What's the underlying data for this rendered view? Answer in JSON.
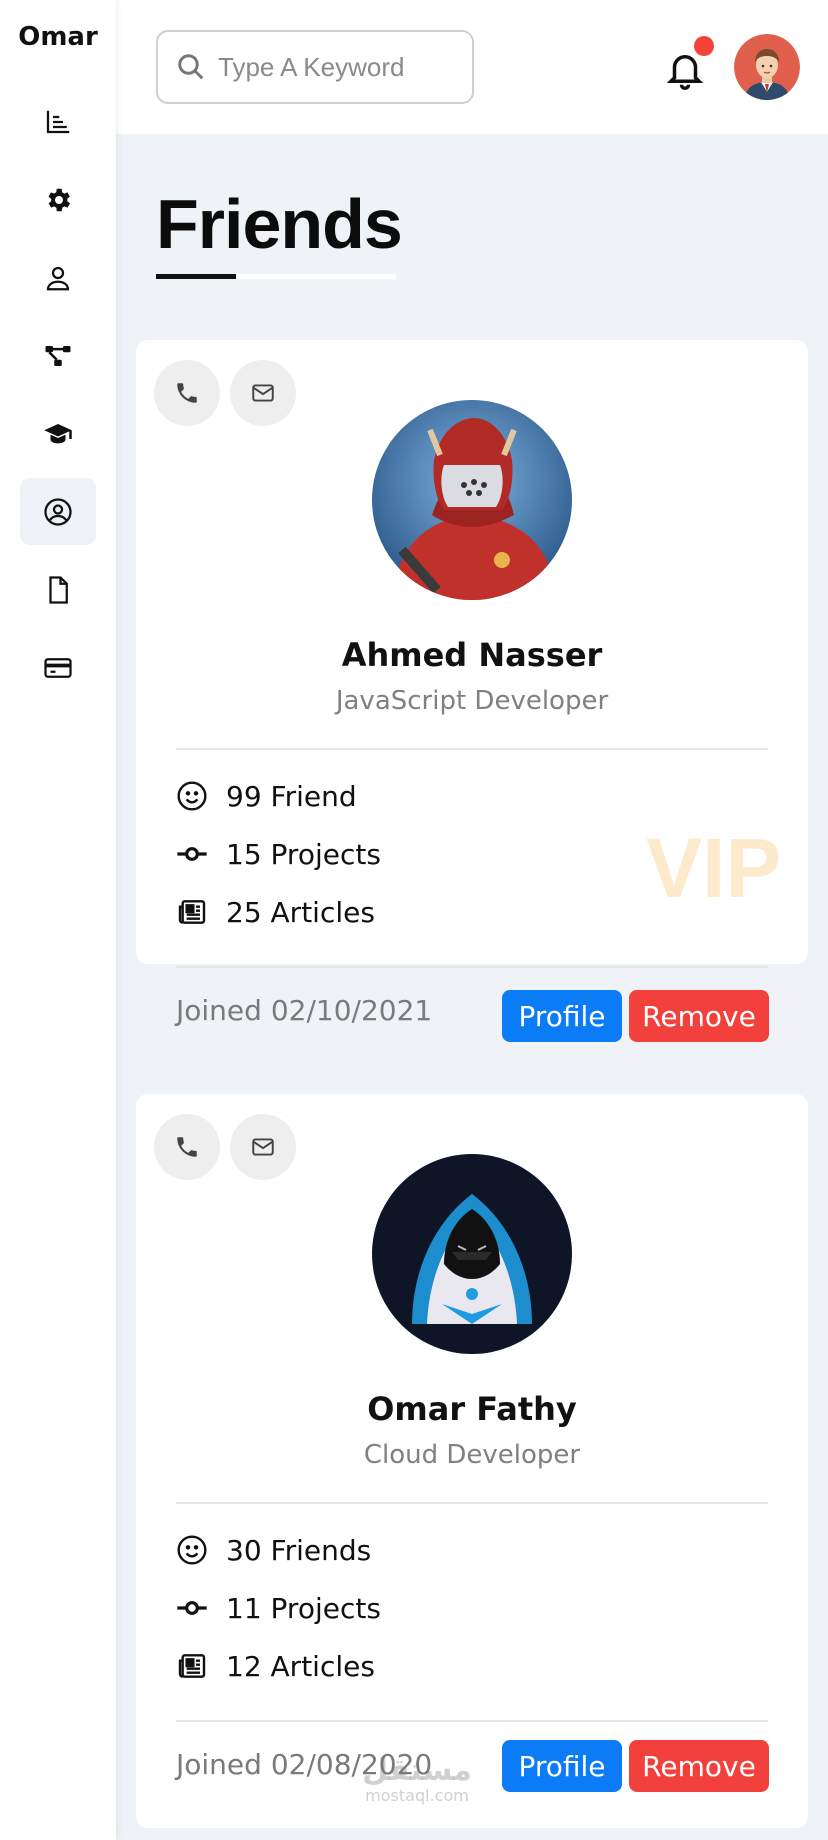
{
  "sidebar": {
    "brand": "Omar",
    "items": [
      {
        "icon": "chart-icon"
      },
      {
        "icon": "gear-icon"
      },
      {
        "icon": "user-icon"
      },
      {
        "icon": "diagram-icon"
      },
      {
        "icon": "graduation-cap-icon"
      },
      {
        "icon": "user-circle-icon",
        "active": true
      },
      {
        "icon": "file-icon"
      },
      {
        "icon": "credit-card-icon"
      }
    ]
  },
  "header": {
    "search_placeholder": "Type A Keyword",
    "notification_color": "#f44336"
  },
  "main": {
    "title": "Friends"
  },
  "friends": [
    {
      "name": "Ahmed Nasser",
      "role": "JavaScript Developer",
      "friends": "99 Friend",
      "projects": "15 Projects",
      "articles": "25 Articles",
      "badge": "VIP",
      "joined": "Joined 02/10/2021",
      "profile_label": "Profile",
      "remove_label": "Remove"
    },
    {
      "name": "Omar Fathy",
      "role": "Cloud Developer",
      "friends": "30 Friends",
      "projects": "11 Projects",
      "articles": "12 Articles",
      "joined": "Joined 02/08/2020",
      "profile_label": "Profile",
      "remove_label": "Remove"
    }
  ],
  "watermark": {
    "arabic": "مستقل",
    "site": "mostaql.com"
  },
  "colors": {
    "primary": "#0b7bf6",
    "danger": "#f2403c",
    "background": "#eff2f6",
    "vip": "#fde9cc"
  }
}
